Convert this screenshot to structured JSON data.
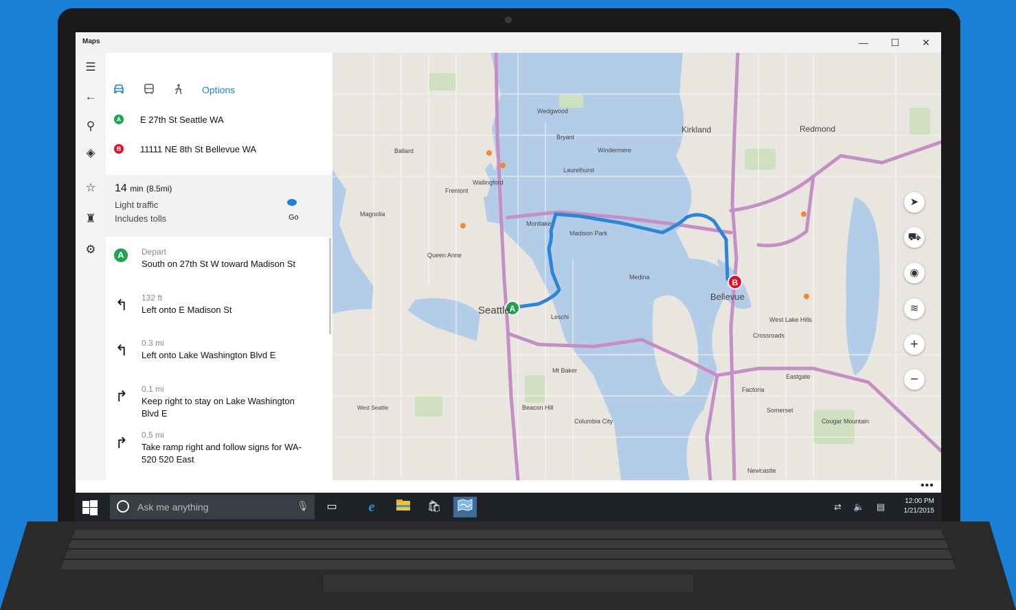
{
  "window": {
    "title": "Maps",
    "minimize": "—",
    "maximize": "☐",
    "close": "✕"
  },
  "rail": {
    "menu": "☰",
    "back": "←",
    "search": "⚲",
    "directions": "◈",
    "favorites": "☆",
    "cities": "♜",
    "settings": "⚙"
  },
  "directions": {
    "modes": [
      {
        "name": "car-icon",
        "glyph": "🚗"
      },
      {
        "name": "bus-icon",
        "glyph": "🚌"
      },
      {
        "name": "walk-icon",
        "glyph": "🚶"
      }
    ],
    "options_label": "Options",
    "start": {
      "badge": "A",
      "text": "E 27th St  Seattle WA",
      "color": "#1fa34a"
    },
    "end": {
      "badge": "B",
      "text": "11111 NE 8th St  Bellevue WA",
      "color": "#e0102a"
    },
    "summary": {
      "time": "14",
      "time_unit": "min",
      "distance": "(8.5mi)",
      "traffic": "Light traffic",
      "tolls": "Includes tolls",
      "go_label": "Go"
    },
    "steps": [
      {
        "icon": "A",
        "dist": "Depart",
        "text": "South on 27th St W toward Madison St"
      },
      {
        "icon": "↰",
        "dist": "132 ft",
        "text": "Left onto E Madison St"
      },
      {
        "icon": "↰",
        "dist": "0.3 mi",
        "text": "Left onto Lake Washington Blvd E"
      },
      {
        "icon": "↱",
        "dist": "0.1 mi",
        "text": "Keep right to stay on Lake Washington Blvd E"
      },
      {
        "icon": "↱",
        "dist": "0.5 mi",
        "text": "Take ramp right and follow signs for WA-520 520 East"
      }
    ]
  },
  "map": {
    "labels": {
      "seattle": "Seattle",
      "bellevue": "Bellevue",
      "kirkland": "Kirkland",
      "redmond": "Redmond",
      "medina": "Medina",
      "somerset": "Somerset",
      "west_seattle": "West Seattle",
      "wedgwood": "Wedgwood",
      "bryant": "Bryant",
      "windermere": "Windermere",
      "laurelhurst": "Laurelhurst",
      "crossroads": "Crossroads",
      "eastgate": "Eastgate",
      "factoria": "Factoria",
      "montlake": "Montlake",
      "madison_park": "Madison Park",
      "leschi": "Leschi",
      "mount_baker": "Mt Baker",
      "columbia_city": "Columbia City",
      "beacon_hill": "Beacon Hill",
      "west_lake_hills": "West Lake Hills",
      "cougar_mountain": "Cougar Mountain",
      "newcastle": "Newcastle",
      "ballard": "Ballard",
      "fremont": "Fremont",
      "wallingford": "Wallingford",
      "magnolia": "Magnolia",
      "queen_anne": "Queen Anne"
    },
    "markers": {
      "a": "A",
      "b": "B"
    },
    "controls": {
      "compass": "➤",
      "traffic": "⛟",
      "location": "◉",
      "layers": "≋",
      "zoom_in": "+",
      "zoom_out": "−"
    },
    "more": "•••",
    "colors": {
      "water": "#b3cde8",
      "land": "#e8e6df",
      "highway": "#c58ec6",
      "route": "#2b86d6"
    }
  },
  "taskbar": {
    "search_placeholder": "Ask me anything",
    "time": "12:00 PM",
    "date": "1/21/2015"
  }
}
